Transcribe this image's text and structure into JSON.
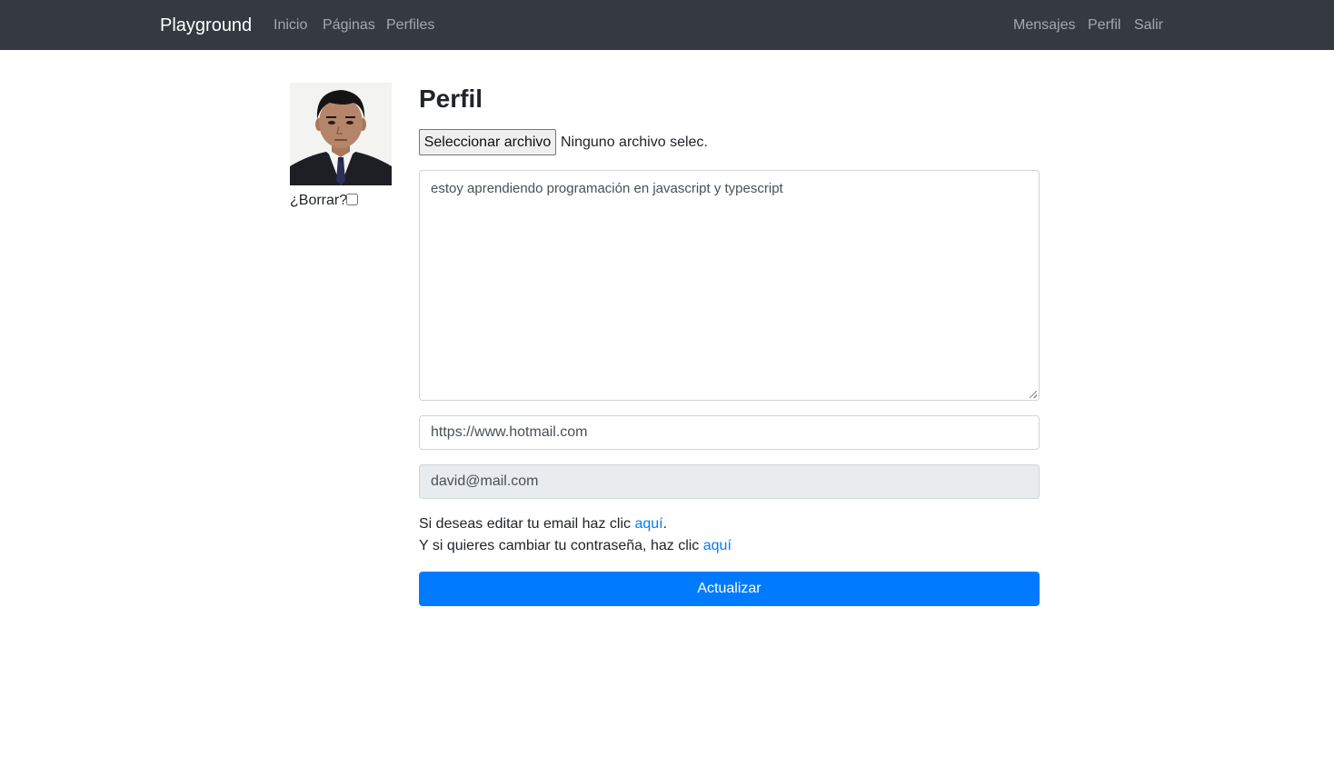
{
  "navbar": {
    "brand": "Playground",
    "left_links": [
      {
        "label": "Inicio"
      },
      {
        "label": "Páginas"
      },
      {
        "label": "Perfiles"
      }
    ],
    "right_links": [
      {
        "label": "Mensajes"
      },
      {
        "label": "Perfil"
      },
      {
        "label": "Salir"
      }
    ]
  },
  "profile": {
    "delete_label": "¿Borrar?",
    "delete_checked": false,
    "title": "Perfil",
    "file_button": "Seleccionar archivo",
    "file_status": "Ninguno archivo selec.",
    "bio": "estoy aprendiendo programación en javascript y typescript",
    "link_url": "https://www.hotmail.com",
    "email": "david@mail.com",
    "help_email_text": "Si deseas editar tu email haz clic ",
    "help_email_link": "aquí",
    "help_email_suffix": ".",
    "help_password_text": "Y si quieres cambiar tu contraseña, haz clic ",
    "help_password_link": "aquí",
    "submit": "Actualizar"
  },
  "colors": {
    "navbar_bg": "#343a40",
    "primary": "#007bff",
    "disabled_input_bg": "#e9ecef"
  }
}
